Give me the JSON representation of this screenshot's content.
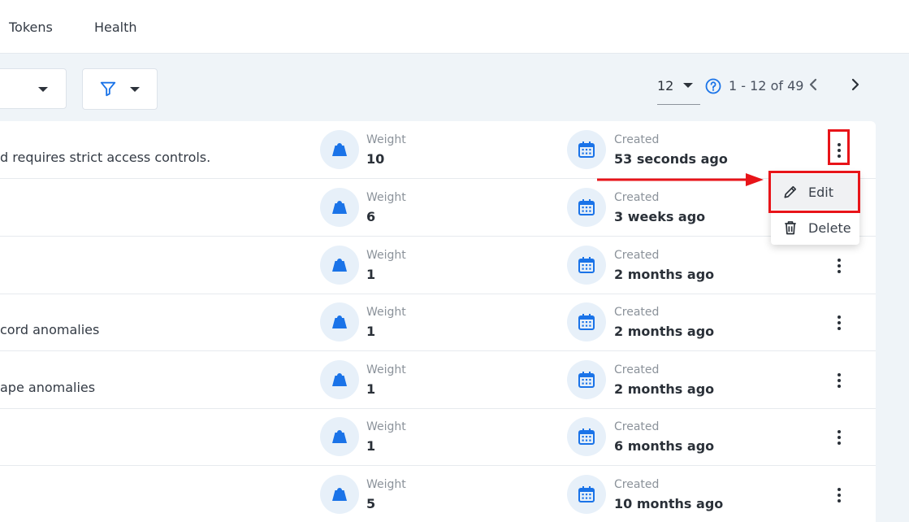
{
  "tabs": [
    "Tokens",
    "Health"
  ],
  "pagination": {
    "page_size": "12",
    "range": "1 - 12 of 49"
  },
  "rows": [
    {
      "desc": "d requires strict access controls.",
      "weight_label": "Weight",
      "weight": "10",
      "created_label": "Created",
      "created": "53 seconds ago"
    },
    {
      "desc": "",
      "weight_label": "Weight",
      "weight": "6",
      "created_label": "Created",
      "created": "3 weeks ago"
    },
    {
      "desc": "",
      "weight_label": "Weight",
      "weight": "1",
      "created_label": "Created",
      "created": "2 months ago"
    },
    {
      "desc": "cord anomalies",
      "weight_label": "Weight",
      "weight": "1",
      "created_label": "Created",
      "created": "2 months ago"
    },
    {
      "desc": "ape anomalies",
      "weight_label": "Weight",
      "weight": "1",
      "created_label": "Created",
      "created": "2 months ago"
    },
    {
      "desc": "",
      "weight_label": "Weight",
      "weight": "1",
      "created_label": "Created",
      "created": "6 months ago"
    },
    {
      "desc": "",
      "weight_label": "Weight",
      "weight": "5",
      "created_label": "Created",
      "created": "10 months ago"
    }
  ],
  "menu": {
    "edit": "Edit",
    "delete": "Delete"
  },
  "colors": {
    "accent": "#1a73e8",
    "highlight": "#e81419",
    "icon_bg": "#e7f0f9"
  }
}
